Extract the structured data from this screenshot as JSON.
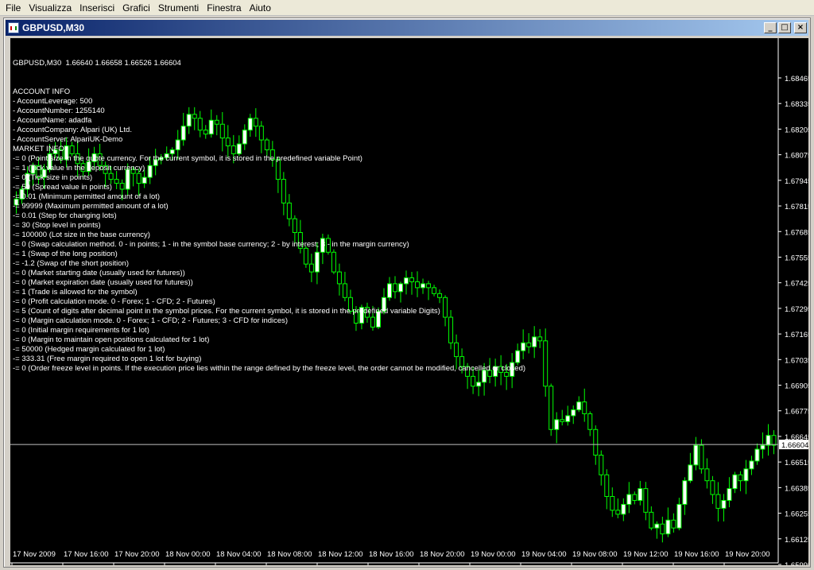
{
  "menu": {
    "items": [
      {
        "label": "File"
      },
      {
        "label": "Visualizza"
      },
      {
        "label": "Inserisci"
      },
      {
        "label": "Grafici"
      },
      {
        "label": "Strumenti"
      },
      {
        "label": "Finestra"
      },
      {
        "label": "Aiuto"
      }
    ]
  },
  "window": {
    "title": "GBPUSD,M30",
    "minimize_icon": "minimize-icon",
    "restore_icon": "restore-icon",
    "close_icon": "close-icon"
  },
  "info": {
    "symbol_line": "GBPUSD,M30  1.66640 1.66658 1.66526 1.66604",
    "lines": [
      "ACCOUNT INFO",
      "- AccountLeverage: 500",
      "- AccountNumber: 1255140",
      "- AccountName: adadfa",
      "- AccountCompany: Alpari (UK) Ltd.",
      "- AccountServer: AlpariUK-Demo",
      "MARKET INFO",
      "-= 0 (Point size in the quote currency. For the current symbol, it is stored in the predefined variable Point)",
      "-= 1 (Tick value in the deposit currency)",
      "-= 0 (Tick size in points)",
      "-= 50 (Spread value in points)",
      "-= 0.01 (Minimum permitted amount of a lot)",
      "-= 99999 (Maximum permitted amount of a lot)",
      "-= 0.01 (Step for changing lots)",
      "-= 30 (Stop level in points)",
      "-= 100000 (Lot size in the base currency)",
      "-= 0 (Swap calculation method. 0 - in points; 1 - in the symbol base currency; 2 - by interest; 3 - in the margin currency)",
      "-= 1 (Swap of the long position)",
      "-= -1.2 (Swap of the short position)",
      "-= 0 (Market starting date (usually used for futures))",
      "-= 0 (Market expiration date (usually used for futures))",
      "-= 1 (Trade is allowed for the symbol)",
      "-= 0 (Profit calculation mode. 0 - Forex; 1 - CFD; 2 - Futures)",
      "-= 5 (Count of digits after decimal point in the symbol prices. For the current symbol, it is stored in the predefined variable Digits)",
      "-= 0 (Margin calculation mode. 0 - Forex; 1 - CFD; 2 - Futures; 3 - CFD for indices)",
      "-= 0 (Initial margin requirements for 1 lot)",
      "-= 0 (Margin to maintain open positions calculated for 1 lot)",
      "-= 50000 (Hedged margin calculated for 1 lot)",
      "-= 333.31 (Free margin required to open 1 lot for buying)",
      "-= 0 (Order freeze level in points. If the execution price lies within the range defined by the freeze level, the order cannot be modified, cancelled or closed)"
    ]
  },
  "colors": {
    "background": "#000000",
    "candle": "#00ff00",
    "bull_body": "#ffffff",
    "text": "#ffffff",
    "price_line": "#c0c0c0"
  },
  "chart_data": {
    "type": "candlestick",
    "symbol": "GBPUSD",
    "timeframe": "M30",
    "ohlc_last": {
      "open": 1.6664,
      "high": 1.66658,
      "low": 1.66526,
      "close": 1.66604
    },
    "current_price_label": "1.66604",
    "y_ticks": [
      "1.68465",
      "1.68335",
      "1.68205",
      "1.68075",
      "1.67945",
      "1.67815",
      "1.67685",
      "1.67555",
      "1.67425",
      "1.67295",
      "1.67165",
      "1.67035",
      "1.66905",
      "1.66775",
      "1.66645",
      "1.66515",
      "1.66385",
      "1.66255",
      "1.66125",
      "1.65995"
    ],
    "x_ticks": [
      "17 Nov 2009",
      "17 Nov 16:00",
      "17 Nov 20:00",
      "18 Nov 00:00",
      "18 Nov 04:00",
      "18 Nov 08:00",
      "18 Nov 12:00",
      "18 Nov 16:00",
      "18 Nov 20:00",
      "19 Nov 00:00",
      "19 Nov 04:00",
      "19 Nov 08:00",
      "19 Nov 12:00",
      "19 Nov 16:00",
      "19 Nov 20:00"
    ],
    "ylim": [
      1.65995,
      1.68465
    ],
    "close_path": [
      1.6785,
      1.679,
      1.6798,
      1.6802,
      1.6796,
      1.68,
      1.6808,
      1.681,
      1.6805,
      1.6812,
      1.6808,
      1.6803,
      1.6799,
      1.6804,
      1.6808,
      1.6802,
      1.6798,
      1.6795,
      1.6793,
      1.679,
      1.68,
      1.6798,
      1.6793,
      1.6796,
      1.6802,
      1.6805,
      1.6806,
      1.6808,
      1.681,
      1.6815,
      1.6822,
      1.6828,
      1.6826,
      1.682,
      1.6818,
      1.6825,
      1.6823,
      1.6816,
      1.6812,
      1.6808,
      1.6813,
      1.682,
      1.6826,
      1.6822,
      1.6815,
      1.681,
      1.6805,
      1.6795,
      1.6783,
      1.6775,
      1.6768,
      1.676,
      1.6752,
      1.6748,
      1.6758,
      1.6765,
      1.6758,
      1.6748,
      1.6742,
      1.6735,
      1.6728,
      1.6722,
      1.673,
      1.6725,
      1.672,
      1.6728,
      1.6735,
      1.6742,
      1.6738,
      1.6742,
      1.6745,
      1.6743,
      1.674,
      1.6742,
      1.674,
      1.6737,
      1.6735,
      1.6725,
      1.6712,
      1.6705,
      1.67,
      1.6695,
      1.669,
      1.6692,
      1.6698,
      1.6695,
      1.67,
      1.6697,
      1.6695,
      1.6702,
      1.6708,
      1.6712,
      1.671,
      1.6715,
      1.6713,
      1.669,
      1.6668,
      1.6673,
      1.6672,
      1.6675,
      1.6678,
      1.6682,
      1.6676,
      1.6668,
      1.6655,
      1.6645,
      1.6634,
      1.6627,
      1.6625,
      1.663,
      1.6635,
      1.6632,
      1.6638,
      1.6626,
      1.6618,
      1.662,
      1.6615,
      1.6622,
      1.6618,
      1.663,
      1.6642,
      1.665,
      1.666,
      1.6648,
      1.6642,
      1.6635,
      1.6628,
      1.6632,
      1.6638,
      1.6645,
      1.6642,
      1.6648,
      1.6652,
      1.6658,
      1.666,
      1.6665,
      1.666
    ]
  }
}
